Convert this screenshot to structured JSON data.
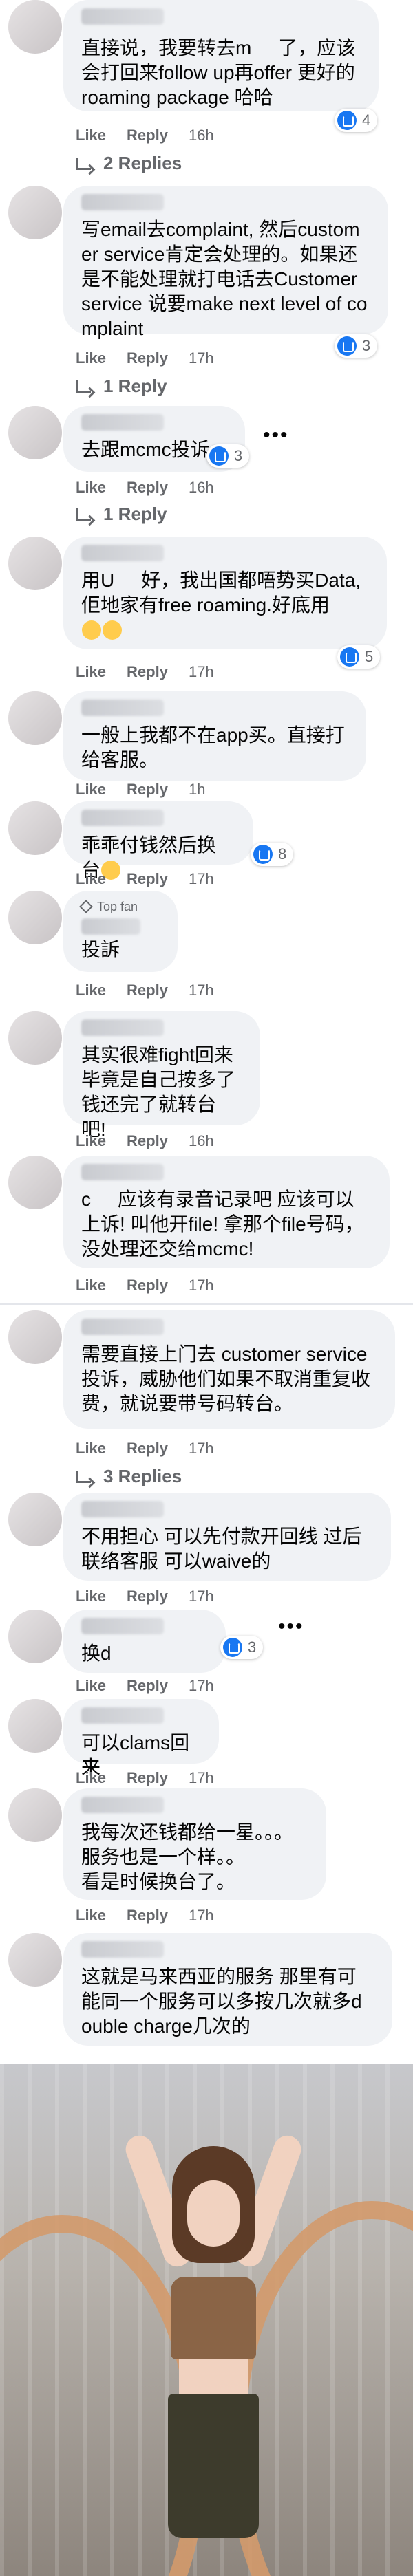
{
  "actions": {
    "like": "Like",
    "reply": "Reply"
  },
  "comments": [
    {
      "text": "直接说，我要转去m     了，应该会打回来follow up再offer 更好的roaming package 哈哈",
      "time": "16h",
      "reactions": "4",
      "replies": "2 Replies"
    },
    {
      "text": "写email去complaint, 然后customer service肯定会处理的。如果还是不能处理就打电话去Customer service 说要make next level of complaint",
      "time": "17h",
      "reactions": "3",
      "replies": "1 Reply"
    },
    {
      "text": "去跟mcmc投诉",
      "time": "16h",
      "reactions": "3",
      "replies": "1 Reply"
    },
    {
      "text": "用U     好，我出国都唔势买Data,佢地家有free roaming.好底用",
      "time": "17h",
      "reactions": "5"
    },
    {
      "text": "一般上我都不在app买。直接打给客服。",
      "time": "1h"
    },
    {
      "text": "乖乖付钱然后换台",
      "time": "17h",
      "reactions": "8"
    },
    {
      "tag": "Top fan",
      "text": "投訴",
      "time": "17h"
    },
    {
      "text": "其实很难fight回来\n毕竟是自己按多了\n钱还完了就转台吧!",
      "time": "16h"
    },
    {
      "text": "c     应该有录音记录吧 应该可以上诉! 叫他开file! 拿那个file号码，没处理还交给mcmc!",
      "time": "17h"
    },
    {
      "text": "需要直接上门去 customer service 投诉，威胁他们如果不取消重复收费，就说要带号码转台。",
      "time": "17h",
      "replies": "3 Replies"
    },
    {
      "text": "不用担心 可以先付款开回线 过后联络客服 可以waive的",
      "time": "17h"
    },
    {
      "text": "换d",
      "time": "17h",
      "reactions": "3"
    },
    {
      "text": "可以clams回来",
      "time": "17h"
    },
    {
      "text": "我每次还钱都给一星。。。\n服务也是一个样。。\n看是时候换台了。",
      "time": "17h"
    },
    {
      "text": "这就是马来西亚的服务 那里有可能同一个服务可以多按几次就多double charge几次的",
      "time": "17h"
    }
  ]
}
